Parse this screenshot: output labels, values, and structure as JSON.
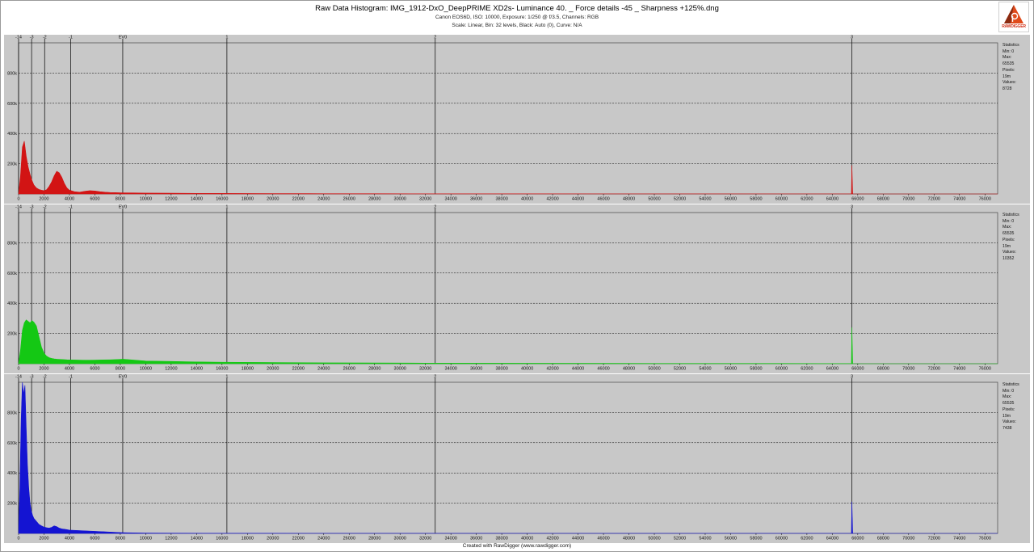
{
  "header": {
    "title": "Raw Data Histogram: IMG_1912-DxO_DeepPRIME XD2s- Luminance 40. _ Force details -45 _ Sharpness +125%.dng",
    "camera_line": "Canon EOS6D, ISO: 10000, Exposure: 1/250 @ f/3.5, Channels: RGB",
    "scale_line": "Scale: Linear, Bin: 32 levels, Black: Auto (0), Curve: N/A"
  },
  "logo": {
    "text": "RAWDIGGER",
    "icon": "rawdigger-logo-icon"
  },
  "footer": {
    "text": "Created with RawDigger (www.rawdigger.com)"
  },
  "colors": {
    "panel_bg": "#c8c8c8",
    "red": "#d21414",
    "green": "#14c814",
    "blue": "#1414d2",
    "grid": "#000000"
  },
  "stats_labels": {
    "title": "Statistics",
    "min": "Min: 0",
    "max": "Max: 65535",
    "pixels": "Pixels: 19m"
  },
  "chart_data": [
    {
      "type": "area",
      "channel": "R",
      "color": "#d21414",
      "xlim": [
        0,
        77000
      ],
      "ylim": [
        0,
        1000000
      ],
      "x_ticks": [
        0,
        2000,
        4000,
        6000,
        8000,
        10000,
        12000,
        14000,
        16000,
        18000,
        20000,
        22000,
        24000,
        26000,
        28000,
        30000,
        32000,
        34000,
        36000,
        38000,
        40000,
        42000,
        44000,
        46000,
        48000,
        50000,
        52000,
        54000,
        56000,
        58000,
        60000,
        62000,
        64000,
        66000,
        68000,
        70000,
        72000,
        74000,
        76000
      ],
      "y_ticks": [
        200000,
        400000,
        600000,
        800000
      ],
      "y_tick_labels": [
        "200k",
        "400k",
        "600k",
        "800k"
      ],
      "ev_ticks": [
        {
          "label": "-14",
          "value": 0
        },
        {
          "label": "-3",
          "value": 1024
        },
        {
          "label": "-2",
          "value": 2048
        },
        {
          "label": "-1",
          "value": 4096
        },
        {
          "label": "EV0",
          "value": 8192
        },
        {
          "label": "1",
          "value": 16384
        },
        {
          "label": "2",
          "value": 32768
        },
        {
          "label": "3",
          "value": 65535
        }
      ],
      "stats_values": "Values: 8728",
      "x": [
        0,
        150,
        300,
        450,
        600,
        750,
        900,
        1050,
        1200,
        1400,
        1600,
        1800,
        2000,
        2200,
        2400,
        2600,
        2800,
        3000,
        3200,
        3400,
        3600,
        3800,
        4000,
        4400,
        4800,
        5200,
        5600,
        6000,
        6400,
        6800,
        7200,
        7600,
        8000,
        9000,
        10000,
        12000,
        14000,
        16000,
        18000,
        20000,
        24000,
        28000,
        32000,
        40000,
        50000,
        60000,
        65400,
        65500,
        65535,
        65600,
        77000
      ],
      "y": [
        0,
        120000,
        310000,
        350000,
        250000,
        180000,
        130000,
        90000,
        60000,
        40000,
        30000,
        25000,
        22000,
        28000,
        50000,
        80000,
        120000,
        150000,
        140000,
        110000,
        70000,
        40000,
        25000,
        15000,
        12000,
        18000,
        22000,
        20000,
        15000,
        12000,
        10000,
        9000,
        8000,
        7000,
        6000,
        5000,
        4000,
        3500,
        3000,
        2500,
        2000,
        1500,
        1200,
        800,
        500,
        300,
        200,
        200,
        190000,
        0,
        0
      ]
    },
    {
      "type": "area",
      "channel": "G",
      "color": "#14c814",
      "xlim": [
        0,
        77000
      ],
      "ylim": [
        0,
        1000000
      ],
      "x_ticks": [
        0,
        2000,
        4000,
        6000,
        8000,
        10000,
        12000,
        14000,
        16000,
        18000,
        20000,
        22000,
        24000,
        26000,
        28000,
        30000,
        32000,
        34000,
        36000,
        38000,
        40000,
        42000,
        44000,
        46000,
        48000,
        50000,
        52000,
        54000,
        56000,
        58000,
        60000,
        62000,
        64000,
        66000,
        68000,
        70000,
        72000,
        74000,
        76000
      ],
      "y_ticks": [
        200000,
        400000,
        600000,
        800000
      ],
      "y_tick_labels": [
        "200k",
        "400k",
        "600k",
        "800k"
      ],
      "ev_ticks": [
        {
          "label": "-14",
          "value": 0
        },
        {
          "label": "-3",
          "value": 1024
        },
        {
          "label": "-2",
          "value": 2048
        },
        {
          "label": "-1",
          "value": 4096
        },
        {
          "label": "EV0",
          "value": 8192
        },
        {
          "label": "1",
          "value": 16384
        },
        {
          "label": "2",
          "value": 32768
        },
        {
          "label": "3",
          "value": 65535
        }
      ],
      "stats_values": "Values: 10352",
      "x": [
        0,
        150,
        300,
        450,
        600,
        750,
        900,
        1050,
        1200,
        1400,
        1600,
        1800,
        2000,
        2200,
        2400,
        2600,
        2800,
        3000,
        3400,
        3800,
        4200,
        4800,
        5400,
        6000,
        6600,
        7200,
        7800,
        8200,
        8800,
        9400,
        10000,
        12000,
        14000,
        16000,
        20000,
        24000,
        28000,
        32000,
        40000,
        50000,
        60000,
        65400,
        65500,
        65535,
        65600,
        77000
      ],
      "y": [
        0,
        90000,
        220000,
        270000,
        290000,
        280000,
        270000,
        285000,
        275000,
        250000,
        180000,
        110000,
        70000,
        50000,
        40000,
        35000,
        32000,
        30000,
        28000,
        26000,
        25000,
        24000,
        23000,
        24000,
        25000,
        26000,
        28000,
        30000,
        26000,
        22000,
        18000,
        15000,
        12000,
        10000,
        8000,
        6000,
        5000,
        4000,
        3000,
        2000,
        1500,
        1200,
        1000,
        240000,
        0,
        0
      ]
    },
    {
      "type": "area",
      "channel": "B",
      "color": "#1414d2",
      "xlim": [
        0,
        77000
      ],
      "ylim": [
        0,
        1000000
      ],
      "x_ticks": [
        0,
        2000,
        4000,
        6000,
        8000,
        10000,
        12000,
        14000,
        16000,
        18000,
        20000,
        22000,
        24000,
        26000,
        28000,
        30000,
        32000,
        34000,
        36000,
        38000,
        40000,
        42000,
        44000,
        46000,
        48000,
        50000,
        52000,
        54000,
        56000,
        58000,
        60000,
        62000,
        64000,
        66000,
        68000,
        70000,
        72000,
        74000,
        76000
      ],
      "y_ticks": [
        200000,
        400000,
        600000,
        800000
      ],
      "y_tick_labels": [
        "200k",
        "400k",
        "600k",
        "800k"
      ],
      "ev_ticks": [
        {
          "label": "-14",
          "value": 0
        },
        {
          "label": "-3",
          "value": 1024
        },
        {
          "label": "-2",
          "value": 2048
        },
        {
          "label": "-1",
          "value": 4096
        },
        {
          "label": "EV0",
          "value": 8192
        },
        {
          "label": "1",
          "value": 16384
        },
        {
          "label": "2",
          "value": 32768
        },
        {
          "label": "3",
          "value": 65535
        }
      ],
      "stats_values": "Values: 7438",
      "x": [
        0,
        100,
        200,
        300,
        400,
        500,
        600,
        700,
        800,
        900,
        1000,
        1100,
        1200,
        1400,
        1600,
        1800,
        2000,
        2200,
        2400,
        2600,
        2800,
        3000,
        3200,
        3400,
        3600,
        3800,
        4000,
        4500,
        5000,
        5500,
        6000,
        6500,
        7000,
        7500,
        8000,
        8500,
        9000,
        10000,
        12000,
        16000,
        20000,
        24000,
        32000,
        40000,
        50000,
        60000,
        65400,
        65500,
        65535,
        65600,
        77000
      ],
      "y": [
        0,
        300000,
        750000,
        1000000,
        920000,
        980000,
        700000,
        450000,
        300000,
        200000,
        150000,
        120000,
        100000,
        80000,
        60000,
        50000,
        42000,
        38000,
        35000,
        40000,
        50000,
        45000,
        35000,
        30000,
        28000,
        25000,
        22000,
        20000,
        18000,
        16000,
        14000,
        12000,
        10000,
        8000,
        6000,
        4500,
        3500,
        2500,
        1500,
        1000,
        800,
        600,
        400,
        300,
        200,
        150,
        120,
        120,
        210000,
        0,
        0
      ]
    }
  ]
}
